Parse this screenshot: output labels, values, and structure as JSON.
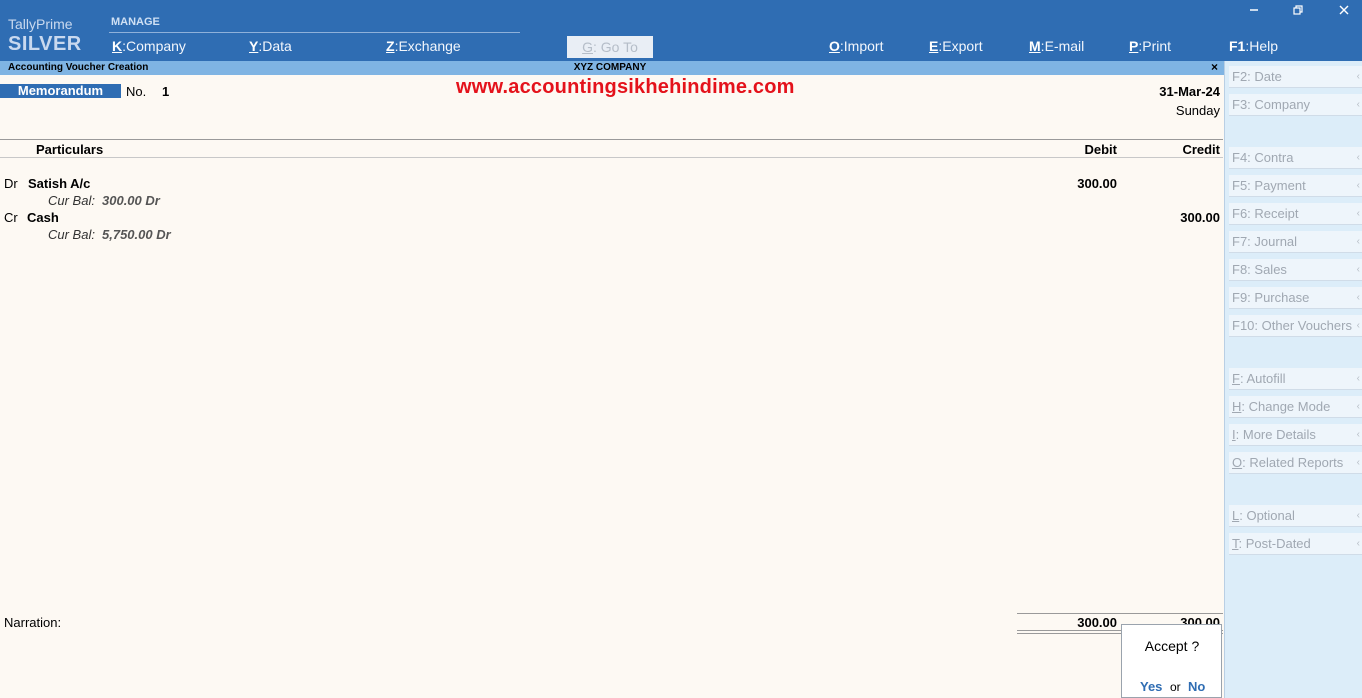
{
  "header": {
    "brand_prime": "TallyPrime",
    "brand_edition": "SILVER",
    "manage_label": "MANAGE",
    "menu": [
      {
        "key": "K",
        "label": "Company"
      },
      {
        "key": "Y",
        "label": "Data"
      },
      {
        "key": "Z",
        "label": "Exchange"
      },
      {
        "key": "G",
        "label": "Go To"
      },
      {
        "key": "O",
        "label": "Import"
      },
      {
        "key": "E",
        "label": "Export"
      },
      {
        "key": "M",
        "label": "E-mail"
      },
      {
        "key": "P",
        "label": "Print"
      },
      {
        "key": "F1",
        "label": "Help"
      }
    ],
    "window_controls": {
      "minimize": "minimize-icon",
      "restore": "restore-icon",
      "close": "close-icon"
    }
  },
  "titlebar": {
    "screen_title": "Accounting Voucher Creation",
    "company": "XYZ COMPANY",
    "close_glyph": "×"
  },
  "voucher": {
    "type": "Memorandum",
    "no_label": "No.",
    "no_value": "1",
    "date": "31-Mar-24",
    "day": "Sunday",
    "watermark": "www.accountingsikhehindime.com",
    "columns": {
      "particulars": "Particulars",
      "debit": "Debit",
      "credit": "Credit"
    },
    "entries": [
      {
        "drcr": "Dr",
        "ledger": "Satish A/c",
        "bal_label": "Cur Bal:",
        "bal_value": "300.00 Dr",
        "debit": "300.00",
        "credit": ""
      },
      {
        "drcr": "Cr",
        "ledger": "Cash",
        "bal_label": "Cur Bal:",
        "bal_value": "5,750.00 Dr",
        "debit": "",
        "credit": "300.00"
      }
    ],
    "narration_label": "Narration:",
    "total_debit": "300.00",
    "total_credit": "300.00"
  },
  "accept_dialog": {
    "question": "Accept ?",
    "yes": "Yes",
    "or": "or",
    "no": "No"
  },
  "rightbar": {
    "buttons": [
      {
        "key": "F2",
        "label": "Date"
      },
      {
        "key": "F3",
        "label": "Company"
      },
      {
        "key": "F4",
        "label": "Contra"
      },
      {
        "key": "F5",
        "label": "Payment"
      },
      {
        "key": "F6",
        "label": "Receipt"
      },
      {
        "key": "F7",
        "label": "Journal"
      },
      {
        "key": "F8",
        "label": "Sales"
      },
      {
        "key": "F9",
        "label": "Purchase"
      },
      {
        "key": "F10",
        "label": "Other Vouchers"
      },
      {
        "key": "F",
        "label": "Autofill"
      },
      {
        "key": "H",
        "label": "Change Mode"
      },
      {
        "key": "I",
        "label": "More Details"
      },
      {
        "key": "O",
        "label": "Related Reports"
      },
      {
        "key": "L",
        "label": "Optional"
      },
      {
        "key": "T",
        "label": "Post-Dated"
      }
    ]
  },
  "colors": {
    "header_blue": "#2f6db3",
    "title_strip": "#7fb4e3",
    "watermark_red": "#e4121b",
    "sidebar_bg": "#dcedf9",
    "body_bg": "#fdf9f3"
  }
}
